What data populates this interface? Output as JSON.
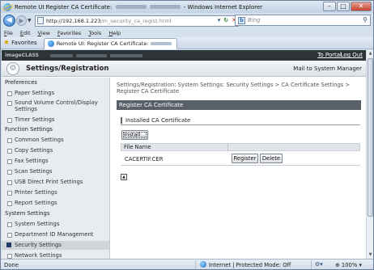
{
  "window": {
    "title_prefix": "Remote UI Register CA Certificate:",
    "title_suffix": "- Windows Internet Explorer",
    "minimize": "–",
    "maximize": "□",
    "close": "✕"
  },
  "addressbar": {
    "url_main": "http://192.168.1.223",
    "url_path": "/m_security_ca_regist.html",
    "search_placeholder": "Bing"
  },
  "menu": [
    "File",
    "Edit",
    "View",
    "Favorites",
    "Tools",
    "Help"
  ],
  "favorites_bar": {
    "label": "Favorites",
    "tab_title": "Remote UI: Register CA Certificate:"
  },
  "page": {
    "brand": "imageCLASS",
    "to_portal": "To Portal",
    "logout": "Log Out",
    "section_title": "Settings/Registration",
    "mail_to_admin": "Mail to System Manager",
    "breadcrumb": "Settings/Registration: System Settings: Security Settings > CA Certificate Settings > Register CA Certificate",
    "page_heading": "Register CA Certificate",
    "subheading": "Installed CA Certificate",
    "install_button": "Install...",
    "table_header_file": "File Name",
    "rows": [
      {
        "file": "CACERTIF.CER",
        "register": "Register",
        "delete": "Delete"
      }
    ]
  },
  "sidebar": {
    "groups": [
      {
        "label": "Preferences",
        "items": [
          "Paper Settings",
          "Sound Volume Control/Display Settings",
          "Timer Settings"
        ]
      },
      {
        "label": "Function Settings",
        "items": [
          "Common Settings",
          "Copy Settings",
          "Fax Settings",
          "Scan Settings",
          "USB Direct Print Settings",
          "Printer Settings",
          "Report Settings"
        ]
      },
      {
        "label": "System Settings",
        "items": [
          "System Settings",
          "Department ID Management",
          "Security Settings",
          "Network Settings"
        ]
      }
    ],
    "active_item": "Security Settings"
  },
  "statusbar": {
    "status": "Done",
    "zone": "Internet | Protected Mode: Off",
    "zoom": "100%"
  },
  "colors": {
    "brand_bar": "#2e3338",
    "page_heading_bar": "#5a6068",
    "sidebar_bg": "#e9ecef",
    "window_frame": "#d6e1ee"
  }
}
